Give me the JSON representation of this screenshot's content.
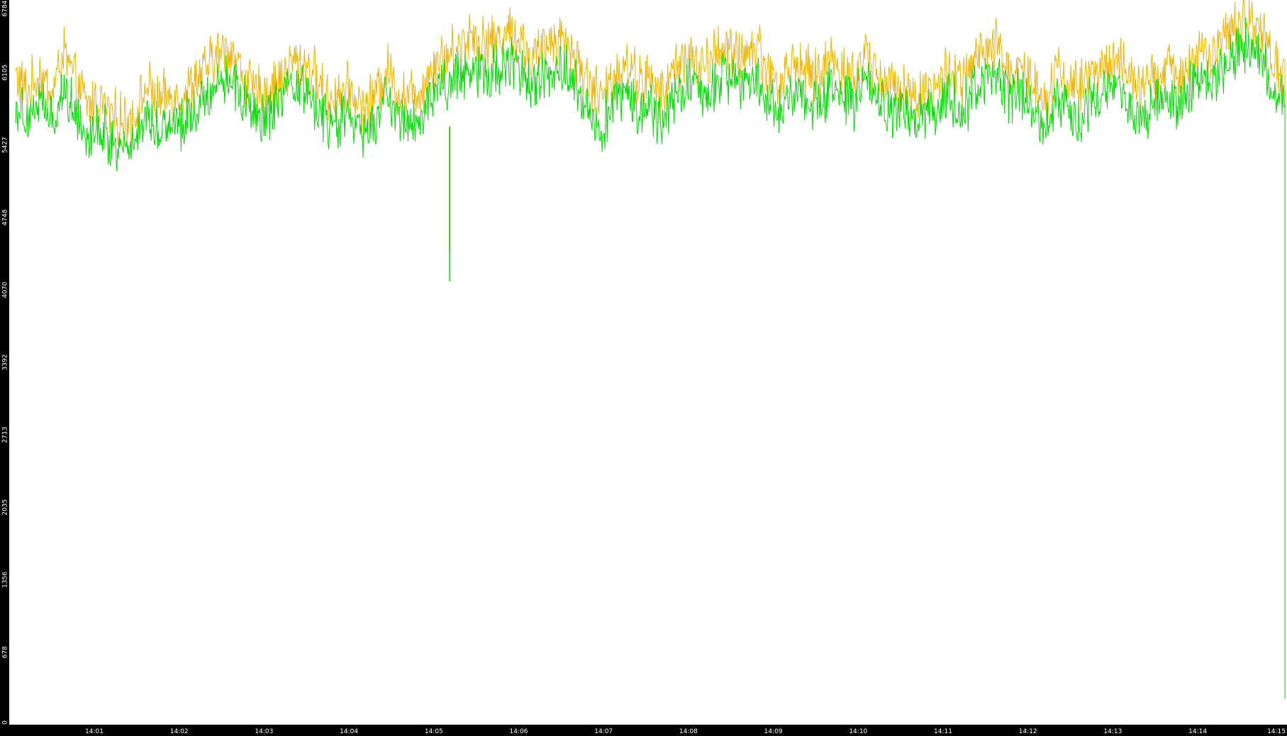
{
  "chart_data": {
    "type": "line",
    "title": "",
    "xlabel": "",
    "ylabel": "",
    "ylim": [
      0,
      6784
    ],
    "y_ticks": [
      0,
      678,
      1356,
      2035,
      2713,
      3392,
      4070,
      4748,
      5427,
      6105,
      6784
    ],
    "x_tick_labels": [
      "14:01",
      "14:02",
      "14:03",
      "14:04",
      "14:05",
      "14:06",
      "14:07",
      "14:08",
      "14:09",
      "14:10",
      "14:11",
      "14:12",
      "14:13",
      "14:14",
      "14:15"
    ],
    "x_range_minutes": [
      14.0,
      15.0
    ],
    "grid": false,
    "legend": "none",
    "background": "#ffffff",
    "frame_color": "#000000",
    "series": [
      {
        "color": "#f0b400",
        "values": [
          6080,
          5920,
          6100,
          5880,
          6300,
          6010,
          5790,
          5850,
          5700,
          5650,
          5710,
          5980,
          5820,
          5900,
          5890,
          6020,
          6150,
          6290,
          6320,
          6080,
          5900,
          5950,
          6000,
          6190,
          6210,
          6080,
          5860,
          5910,
          5940,
          5760,
          5880,
          6150,
          5920,
          5900,
          5960,
          6220,
          6250,
          6340,
          6480,
          6400,
          6390,
          6510,
          6440,
          6230,
          6300,
          6450,
          6410,
          6180,
          6010,
          5840,
          6110,
          6200,
          6050,
          6020,
          5870,
          6150,
          6280,
          6120,
          6220,
          6380,
          6230,
          6310,
          6350,
          6080,
          6000,
          6220,
          6100,
          6050,
          6260,
          6150,
          6030,
          6300,
          6100,
          5960,
          6030,
          5860,
          5980,
          5950,
          6160,
          5990,
          6200,
          6280,
          6350,
          6120,
          6160,
          6020,
          5870,
          6140,
          6010,
          5960,
          6130,
          6180,
          6200,
          6100,
          5930,
          6030,
          6150,
          6080,
          6190,
          6280,
          6260,
          6400,
          6560,
          6630,
          6500,
          6220,
          6050
        ],
        "tail": [
          5950,
          1010,
          860
        ]
      },
      {
        "color": "#00dd00",
        "values": [
          5800,
          5700,
          5850,
          5620,
          5950,
          5760,
          5520,
          5600,
          5450,
          5400,
          5500,
          5700,
          5580,
          5650,
          5640,
          5780,
          5900,
          6030,
          6070,
          5850,
          5650,
          5700,
          5780,
          5940,
          5960,
          5820,
          5600,
          5650,
          5690,
          5510,
          5620,
          5880,
          5680,
          5640,
          5700,
          5950,
          5980,
          6070,
          6180,
          6120,
          6100,
          6210,
          6150,
          5960,
          6040,
          6180,
          6150,
          5920,
          5740,
          5580,
          5840,
          5940,
          5790,
          5760,
          5620,
          5880,
          6020,
          5860,
          5960,
          6100,
          5980,
          6050,
          6080,
          5810,
          5740,
          5960,
          5840,
          5800,
          6000,
          5890,
          5780,
          6040,
          5850,
          5700,
          5780,
          5600,
          5720,
          5700,
          5900,
          5720,
          5930,
          6020,
          6080,
          5860,
          5900,
          5760,
          5610,
          5880,
          5740,
          5700,
          5870,
          5920,
          5940,
          5840,
          5670,
          5780,
          5890,
          5820,
          5930,
          6020,
          6000,
          6140,
          6300,
          6370,
          6240,
          5960,
          5780
        ],
        "tail": [
          5650,
          3020,
          240
        ]
      }
    ],
    "spikes": [
      {
        "series": 0,
        "at_minute": 14.0507,
        "low": 4420
      },
      {
        "series": 1,
        "at_minute": 14.0507,
        "low": 4150
      }
    ]
  }
}
